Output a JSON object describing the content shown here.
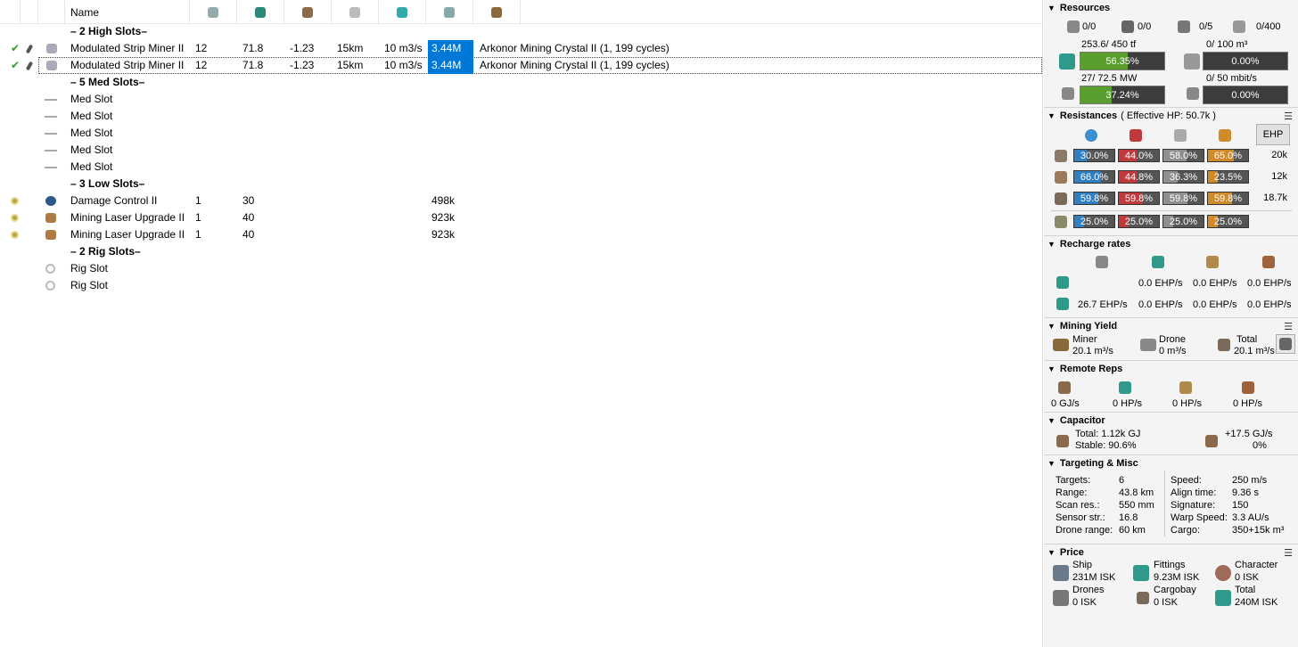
{
  "grid": {
    "header": {
      "name": "Name"
    },
    "sections": {
      "high": "– 2 High Slots–",
      "med": "– 5 Med Slots–",
      "low": "– 3 Low Slots–",
      "rig": "– 2 Rig Slots–"
    },
    "high_rows": [
      {
        "name": "Modulated Strip Miner II",
        "cpu": "12",
        "pg": "71.8",
        "cap": "-1.23",
        "range": "15km",
        "yield": "10 m3/s",
        "price": "3.44M",
        "charge": "Arkonor Mining Crystal II (1, 199 cycles)"
      },
      {
        "name": "Modulated Strip Miner II",
        "cpu": "12",
        "pg": "71.8",
        "cap": "-1.23",
        "range": "15km",
        "yield": "10 m3/s",
        "price": "3.44M",
        "charge": "Arkonor Mining Crystal II (1, 199 cycles)"
      }
    ],
    "med_rows": [
      "Med Slot",
      "Med Slot",
      "Med Slot",
      "Med Slot",
      "Med Slot"
    ],
    "low_rows": [
      {
        "name": "Damage Control II",
        "cpu": "1",
        "pg": "30",
        "price": "498k"
      },
      {
        "name": "Mining Laser Upgrade II",
        "cpu": "1",
        "pg": "40",
        "price": "923k"
      },
      {
        "name": "Mining Laser Upgrade II",
        "cpu": "1",
        "pg": "40",
        "price": "923k"
      }
    ],
    "rig_rows": [
      "Rig Slot",
      "Rig Slot"
    ]
  },
  "panel": {
    "resources": {
      "title": "Resources",
      "counts": [
        "0/0",
        "0/0",
        "0/5",
        "0/400"
      ],
      "cpu_label": "253.6/ 450 tf",
      "cpu_pct": "56.35%",
      "cpu_fill": 0.5635,
      "pg_label": "27/ 72.5 MW",
      "pg_pct": "37.24%",
      "pg_fill": 0.3724,
      "drone_bay_label": "0/ 100 m³",
      "drone_bay_pct": "0.00%",
      "bandwidth_label": "0/ 50 mbit/s",
      "bandwidth_pct": "0.00%"
    },
    "resistances": {
      "title": "Resistances",
      "ehp": "( Effective HP: 50.7k )",
      "ehp_button": "EHP",
      "rows": [
        {
          "values": [
            "30.0%",
            "44.0%",
            "58.0%",
            "65.0%"
          ],
          "fills": [
            0.3,
            0.44,
            0.58,
            0.65
          ],
          "hp": "20k"
        },
        {
          "values": [
            "66.0%",
            "44.8%",
            "36.3%",
            "23.5%"
          ],
          "fills": [
            0.66,
            0.448,
            0.363,
            0.235
          ],
          "hp": "12k"
        },
        {
          "values": [
            "59.8%",
            "59.8%",
            "59.8%",
            "59.8%"
          ],
          "fills": [
            0.598,
            0.598,
            0.598,
            0.598
          ],
          "hp": "18.7k"
        },
        {
          "values": [
            "25.0%",
            "25.0%",
            "25.0%",
            "25.0%"
          ],
          "fills": [
            0.25,
            0.25,
            0.25,
            0.25
          ],
          "hp": ""
        }
      ]
    },
    "recharge": {
      "title": "Recharge rates",
      "row1": [
        "0.0 EHP/s",
        "0.0 EHP/s",
        "0.0 EHP/s"
      ],
      "row2": [
        "26.7 EHP/s",
        "0.0 EHP/s",
        "0.0 EHP/s",
        "0.0 EHP/s"
      ]
    },
    "mining": {
      "title": "Mining Yield",
      "miner_label": "Miner",
      "miner_value": "20.1 m³/s",
      "drone_label": "Drone",
      "drone_value": "0 m³/s",
      "total_label": "Total",
      "total_value": "20.1 m³/s"
    },
    "remote": {
      "title": "Remote Reps",
      "values": [
        "0 GJ/s",
        "0 HP/s",
        "0 HP/s",
        "0 HP/s"
      ]
    },
    "capacitor": {
      "title": "Capacitor",
      "total": "Total:  1.12k GJ",
      "stable": "Stable: 90.6%",
      "delta": "+17.5 GJ/s",
      "delta_pct": "0%"
    },
    "targeting": {
      "title": "Targeting & Misc",
      "left": [
        [
          "Targets:",
          "6"
        ],
        [
          "Range:",
          "43.8 km"
        ],
        [
          "Scan res.:",
          "550 mm"
        ],
        [
          "Sensor str.:",
          "16.8"
        ],
        [
          "Drone range:",
          "60 km"
        ]
      ],
      "right": [
        [
          "Speed:",
          "250 m/s"
        ],
        [
          "Align time:",
          "9.36 s"
        ],
        [
          "Signature:",
          "150"
        ],
        [
          "Warp Speed:",
          "3.3 AU/s"
        ],
        [
          "Cargo:",
          "350+15k m³"
        ]
      ]
    },
    "price": {
      "title": "Price",
      "ship_label": "Ship",
      "ship_value": "231M ISK",
      "fittings_label": "Fittings",
      "fittings_value": "9.23M ISK",
      "character_label": "Character",
      "character_value": "0 ISK",
      "drones_label": "Drones",
      "drones_value": "0 ISK",
      "cargobay_label": "Cargobay",
      "cargobay_value": "0 ISK",
      "total_label": "Total",
      "total_value": "240M ISK"
    }
  },
  "colors": {
    "selection": "#0078d7",
    "cpu_fill": "#5a9e2f",
    "em": "#2f7fc1",
    "thermal": "#c0393b",
    "kinetic": "#8f8f8f",
    "explosive": "#d08a2a"
  }
}
